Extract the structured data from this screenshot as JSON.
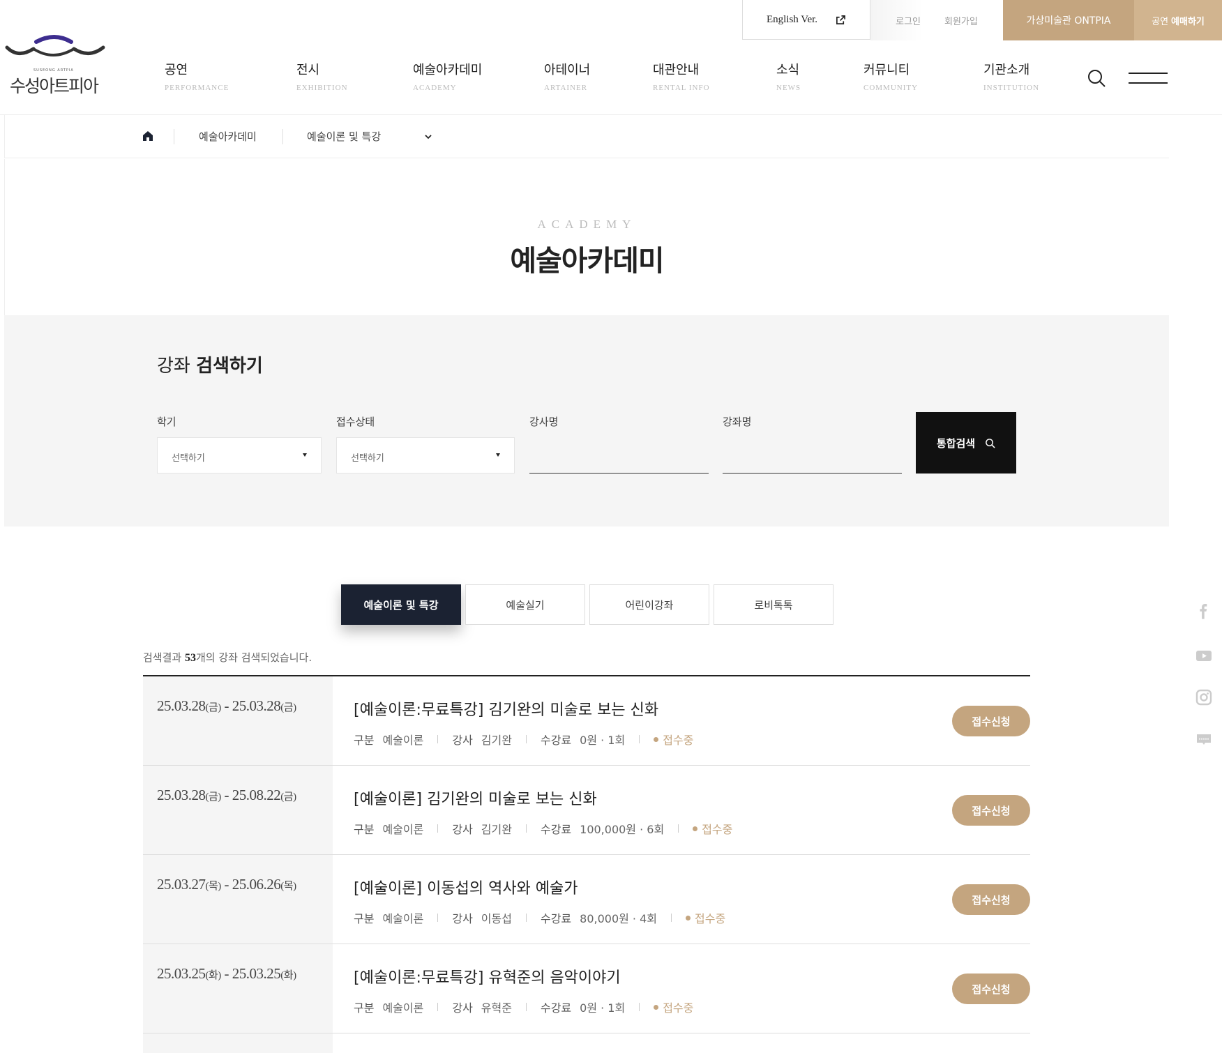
{
  "util": {
    "english": "English Ver.",
    "login": "로그인",
    "join": "회원가입",
    "ontpia": "가상미술관 ONTPIA",
    "ticket_pre": "공연",
    "ticket_bold": "예매하기"
  },
  "logo": {
    "wordmark": "수성아트피아",
    "sub": "SUSEONG ARTPIA"
  },
  "nav": [
    {
      "ko": "공연",
      "en": "PERFORMANCE"
    },
    {
      "ko": "전시",
      "en": "EXHIBITION"
    },
    {
      "ko": "예술아카데미",
      "en": "ACADEMY"
    },
    {
      "ko": "아테이너",
      "en": "ARTAINER"
    },
    {
      "ko": "대관안내",
      "en": "RENTAL INFO"
    },
    {
      "ko": "소식",
      "en": "NEWS"
    },
    {
      "ko": "커뮤니티",
      "en": "COMMUNITY"
    },
    {
      "ko": "기관소개",
      "en": "INSTITUTION"
    }
  ],
  "breadcrumb": {
    "level1": "예술아카데미",
    "level2": "예술이론 및 특강"
  },
  "page": {
    "title_en": "ACADEMY",
    "title_ko": "예술아카데미"
  },
  "search": {
    "heading_light": "강좌",
    "heading_bold": "검색하기",
    "term_label": "학기",
    "term_value": "선택하기",
    "status_label": "접수상태",
    "status_value": "선택하기",
    "teacher_label": "강사명",
    "course_label": "강좌명",
    "button": "통합검색"
  },
  "tabs": [
    {
      "label": "예술이론 및 특강",
      "active": true
    },
    {
      "label": "예술실기",
      "active": false
    },
    {
      "label": "어린이강좌",
      "active": false
    },
    {
      "label": "로비톡톡",
      "active": false
    }
  ],
  "result": {
    "pre": "검색결과",
    "count": "53",
    "post": "개의 강좌 검색되었습니다."
  },
  "labels": {
    "category": "구분",
    "teacher": "강사",
    "fee": "수강료",
    "apply": "접수신청"
  },
  "courses": [
    {
      "start": "25.03.28",
      "start_day": "(금)",
      "end": "25.03.28",
      "end_day": "(금)",
      "title": "[예술이론:무료특강] 김기완의 미술로 보는 신화",
      "category": "예술이론",
      "teacher": "김기완",
      "fee": "0원 · 1회",
      "status": "접수중"
    },
    {
      "start": "25.03.28",
      "start_day": "(금)",
      "end": "25.08.22",
      "end_day": "(금)",
      "title": "[예술이론] 김기완의 미술로 보는 신화",
      "category": "예술이론",
      "teacher": "김기완",
      "fee": "100,000원 · 6회",
      "status": "접수중"
    },
    {
      "start": "25.03.27",
      "start_day": "(목)",
      "end": "25.06.26",
      "end_day": "(목)",
      "title": "[예술이론] 이동섭의 역사와 예술가",
      "category": "예술이론",
      "teacher": "이동섭",
      "fee": "80,000원 · 4회",
      "status": "접수중"
    },
    {
      "start": "25.03.25",
      "start_day": "(화)",
      "end": "25.03.25",
      "end_day": "(화)",
      "title": "[예술이론:무료특강] 유혁준의 음악이야기",
      "category": "예술이론",
      "teacher": "유혁준",
      "fee": "0원 · 1회",
      "status": "접수중"
    }
  ],
  "social": [
    "facebook-icon",
    "youtube-icon",
    "instagram-icon",
    "blog-icon"
  ],
  "colors": {
    "accent": "#c4a57f",
    "dark": "#1b2232",
    "logo_purple": "#3d2d8f"
  }
}
